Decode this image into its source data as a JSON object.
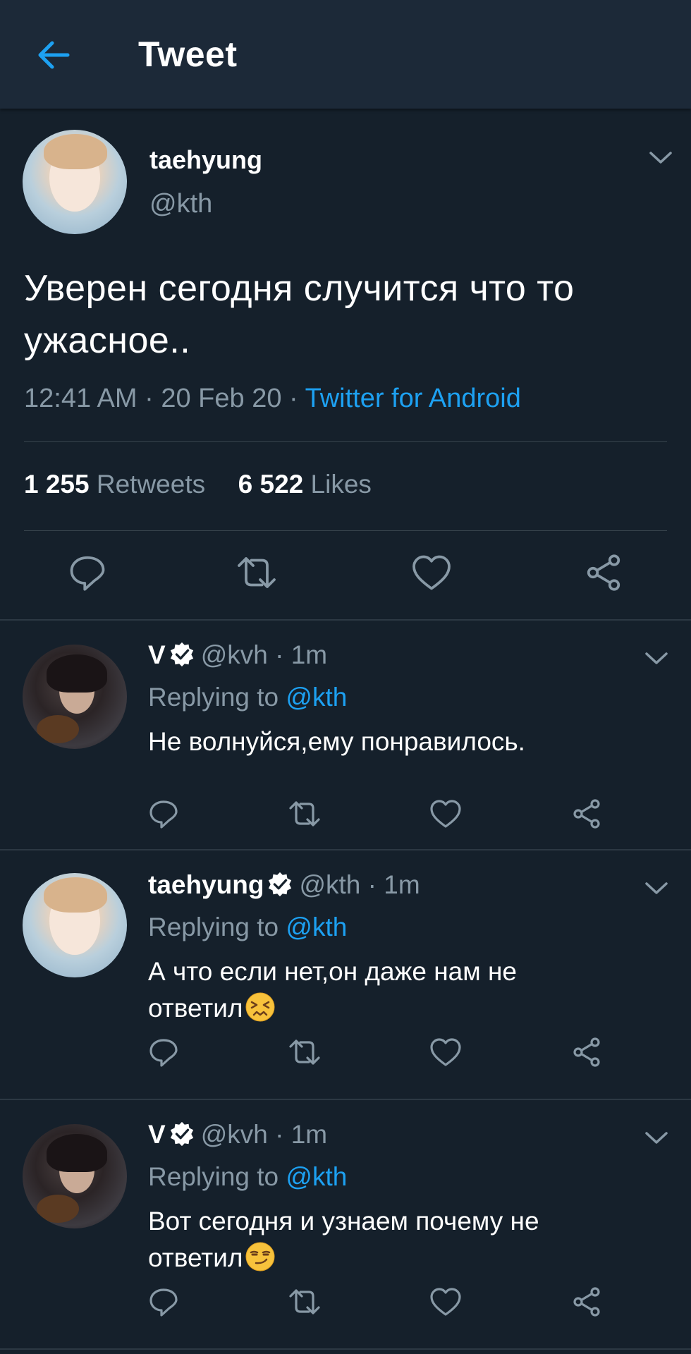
{
  "appbar": {
    "title": "Tweet"
  },
  "colors": {
    "background": "#15202b",
    "appbar": "#1c2938",
    "accent": "#1da1f2",
    "muted": "#8899a6",
    "divider": "#38444d"
  },
  "main_tweet": {
    "name": "taehyung",
    "handle": "@kth",
    "text": "Уверен сегодня случится что то ужасное..",
    "time": "12:41 AM",
    "date": "20 Feb 20",
    "source": "Twitter for Android",
    "retweets_count": "1 255",
    "retweets_label": "Retweets",
    "likes_count": "6 522",
    "likes_label": "Likes"
  },
  "replies": [
    {
      "name": "V",
      "verified": true,
      "handle": "@kvh",
      "age": "1m",
      "replying_label": "Replying to",
      "replying_to": "@kth",
      "text": "Не волнуйся,ему понравилось.",
      "emoji": ""
    },
    {
      "name": "taehyung",
      "verified": true,
      "handle": "@kth",
      "age": "1m",
      "replying_label": "Replying to",
      "replying_to": "@kth",
      "text": "А что если нет,он даже нам не ответил",
      "emoji": "persevering-face"
    },
    {
      "name": "V",
      "verified": true,
      "handle": "@kvh",
      "age": "1m",
      "replying_label": "Replying to",
      "replying_to": "@kth",
      "text": "Вот сегодня и узнаем почему не ответил",
      "emoji": "smirking-face"
    }
  ],
  "icons": [
    "back-arrow-icon",
    "chevron-down-icon",
    "reply-icon",
    "retweet-icon",
    "like-icon",
    "share-icon",
    "verified-icon"
  ]
}
